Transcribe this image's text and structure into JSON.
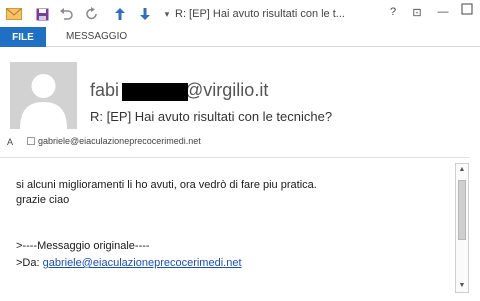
{
  "window": {
    "title": "R: [EP] Hai avuto risultati con le t...",
    "controls": [
      "?",
      "⊡",
      "—"
    ]
  },
  "tabs": {
    "file": "FILE",
    "message": "MESSAGGIO"
  },
  "header": {
    "from_prefix": "fabi",
    "from_suffix": "@virgilio.it",
    "subject": "R: [EP] Hai avuto risultati con le tecniche?",
    "to_label": "A",
    "to_address": "gabriele@eiaculazioneprecocerimedi.net"
  },
  "body": {
    "line1": "si alcuni miglioramenti li ho avuti, ora vedrò di fare piu pratica.",
    "line2": "grazie ciao",
    "quote_header": ">----Messaggio originale----",
    "quote_from_label": ">Da: ",
    "quote_from_link": "gabriele@eiaculazioneprecocerimedi.net"
  }
}
